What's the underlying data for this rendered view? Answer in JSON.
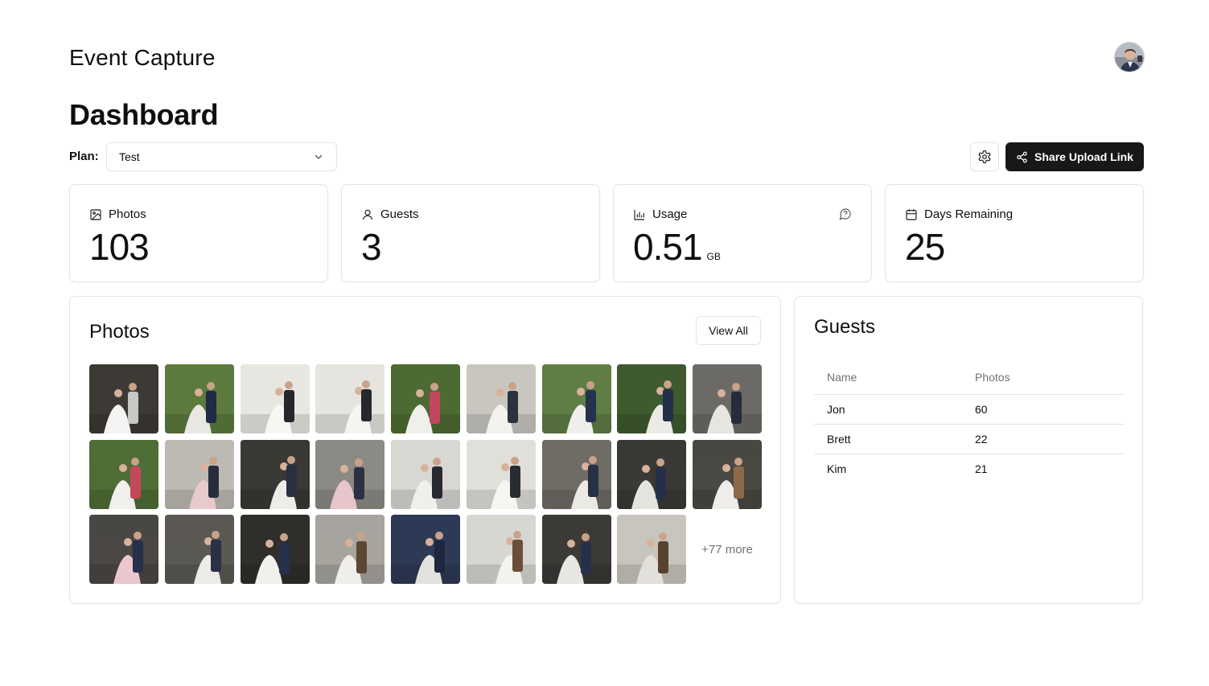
{
  "app": {
    "title": "Event Capture",
    "avatar_icon": "user-avatar"
  },
  "page": {
    "title": "Dashboard"
  },
  "plan": {
    "label": "Plan:",
    "selected": "Test"
  },
  "toolbar": {
    "settings_icon": "gear-icon",
    "share_label": "Share Upload Link",
    "share_icon": "share-icon"
  },
  "stats": {
    "photos": {
      "label": "Photos",
      "value": "103",
      "icon": "image-icon"
    },
    "guests": {
      "label": "Guests",
      "value": "3",
      "icon": "user-icon"
    },
    "usage": {
      "label": "Usage",
      "value": "0.51",
      "unit": "GB",
      "icon": "bar-chart-icon",
      "aux_icon": "help-icon"
    },
    "days": {
      "label": "Days Remaining",
      "value": "25",
      "icon": "calendar-icon"
    }
  },
  "photos_panel": {
    "title": "Photos",
    "view_all": "View All",
    "more_text": "+77 more",
    "thumbnails": [
      {
        "bg": "#3d3a35",
        "accent": "#f4f4f2",
        "detail": "#c7c7c3"
      },
      {
        "bg": "#5c7a3e",
        "accent": "#e9e7e2",
        "detail": "#1f2a44"
      },
      {
        "bg": "#e8e6e1",
        "accent": "#f7f6f3",
        "detail": "#24262c"
      },
      {
        "bg": "#e6e4df",
        "accent": "#f5f4f0",
        "detail": "#26282e"
      },
      {
        "bg": "#4d6a32",
        "accent": "#f0efeb",
        "detail": "#c0475e"
      },
      {
        "bg": "#c9c6c0",
        "accent": "#f3f2ef",
        "detail": "#2c3140"
      },
      {
        "bg": "#5f7d45",
        "accent": "#efeeea",
        "detail": "#25324e"
      },
      {
        "bg": "#3f5a2e",
        "accent": "#eceae5",
        "detail": "#233049"
      },
      {
        "bg": "#6b6a66",
        "accent": "#e7e5e0",
        "detail": "#272c3a"
      },
      {
        "bg": "#4f6e36",
        "accent": "#f1f0ec",
        "detail": "#c4475a"
      },
      {
        "bg": "#bdbab3",
        "accent": "#e8c9cc",
        "detail": "#282d3b"
      },
      {
        "bg": "#3a3834",
        "accent": "#eeece8",
        "detail": "#2a3042"
      },
      {
        "bg": "#8c8a84",
        "accent": "#e7c6cb",
        "detail": "#2b3142"
      },
      {
        "bg": "#d9d7d2",
        "accent": "#f0efeb",
        "detail": "#272a33"
      },
      {
        "bg": "#e1dfda",
        "accent": "#f6f5f2",
        "detail": "#2a2c33"
      },
      {
        "bg": "#6f6c66",
        "accent": "#ebe9e4",
        "detail": "#263046"
      },
      {
        "bg": "#3b3935",
        "accent": "#e5e3de",
        "detail": "#243049"
      },
      {
        "bg": "#4a4843",
        "accent": "#eeede9",
        "detail": "#8a6a4a"
      },
      {
        "bg": "#4a4744",
        "accent": "#e9c7cc",
        "detail": "#26304a"
      },
      {
        "bg": "#5b5954",
        "accent": "#ecebe6",
        "detail": "#2a3145"
      },
      {
        "bg": "#2f2e2b",
        "accent": "#f1f0ec",
        "detail": "#26304a"
      },
      {
        "bg": "#a7a49e",
        "accent": "#efeeea",
        "detail": "#5e4634"
      },
      {
        "bg": "#2e3a55",
        "accent": "#e4e2dd",
        "detail": "#1f2740"
      },
      {
        "bg": "#d8d6d1",
        "accent": "#f3f2ee",
        "detail": "#6a4e3a"
      },
      {
        "bg": "#3c3a37",
        "accent": "#e8e6e1",
        "detail": "#27304a"
      },
      {
        "bg": "#c8c5be",
        "accent": "#e2e0db",
        "detail": "#5a4230"
      }
    ]
  },
  "guests_panel": {
    "title": "Guests",
    "columns": [
      "Name",
      "Photos"
    ],
    "rows": [
      [
        "Jon",
        "60"
      ],
      [
        "Brett",
        "22"
      ],
      [
        "Kim",
        "21"
      ]
    ]
  }
}
